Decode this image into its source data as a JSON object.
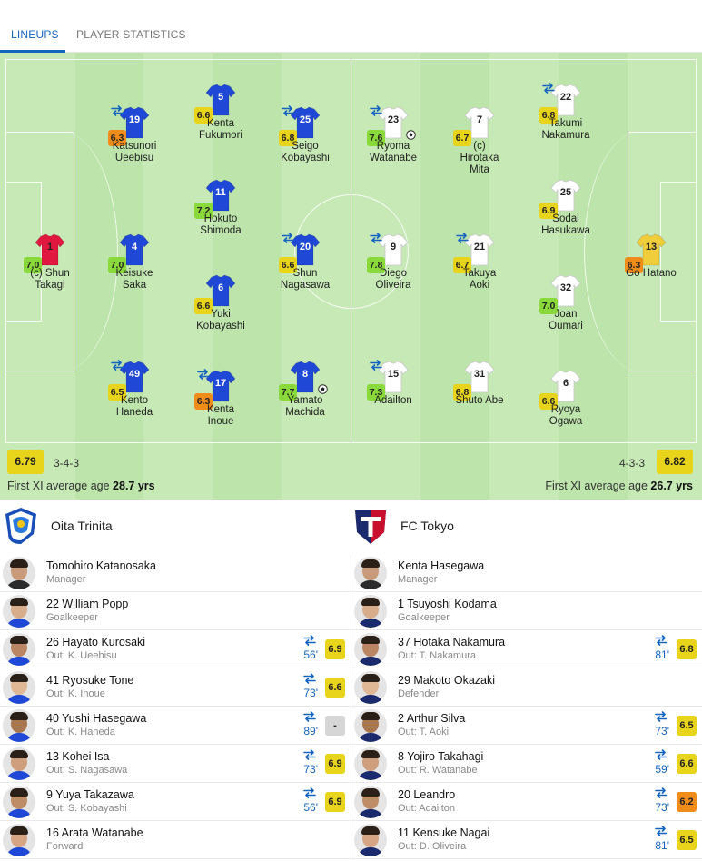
{
  "tabs": [
    {
      "label": "LINEUPS",
      "active": true
    },
    {
      "label": "PLAYER STATISTICS",
      "active": false
    }
  ],
  "colors": {
    "accent": "#1565c0",
    "home_kit": "#1f48d6",
    "away_kit": "#ffffff",
    "home_gk": "#e0173f",
    "away_gk": "#f0cd3a"
  },
  "lineups": {
    "home": {
      "average_rating": "6.79",
      "formation": "3-4-3",
      "avg_age_label": "First XI average age",
      "avg_age_value": "28.7 yrs",
      "players": [
        {
          "number": "1",
          "name": "(c) Shun\nTakagi",
          "rating": "7.0",
          "rc": "r-green",
          "gk": true
        },
        {
          "number": "4",
          "name": "Keisuke\nSaka",
          "rating": "7.0",
          "rc": "r-green"
        },
        {
          "number": "19",
          "name": "Katsunori\nUeebisu",
          "rating": "6.3",
          "rc": "r-orange",
          "sub": true
        },
        {
          "number": "49",
          "name": "Kento\nHaneda",
          "rating": "6.5",
          "rc": "r-yellow",
          "sub": true
        },
        {
          "number": "5",
          "name": "Kenta\nFukumori",
          "rating": "6.6",
          "rc": "r-yellow"
        },
        {
          "number": "11",
          "name": "Hokuto\nShimoda",
          "rating": "7.2",
          "rc": "r-green"
        },
        {
          "number": "6",
          "name": "Yuki\nKobayashi",
          "rating": "6.6",
          "rc": "r-yellow"
        },
        {
          "number": "17",
          "name": "Kenta\nInoue",
          "rating": "6.3",
          "rc": "r-orange",
          "sub": true
        },
        {
          "number": "25",
          "name": "Seigo\nKobayashi",
          "rating": "6.8",
          "rc": "r-yellow",
          "sub": true
        },
        {
          "number": "20",
          "name": "Shun\nNagasawa",
          "rating": "6.6",
          "rc": "r-yellow",
          "sub": true
        },
        {
          "number": "8",
          "name": "Yamato\nMachida",
          "rating": "7.7",
          "rc": "r-green",
          "goal": true
        }
      ]
    },
    "away": {
      "average_rating": "6.82",
      "formation": "4-3-3",
      "avg_age_label": "First XI average age",
      "avg_age_value": "26.7 yrs",
      "players": [
        {
          "number": "23",
          "name": "Ryoma\nWatanabe",
          "rating": "7.6",
          "rc": "r-green",
          "sub": true,
          "goal": true
        },
        {
          "number": "9",
          "name": "Diego\nOliveira",
          "rating": "7.8",
          "rc": "r-green",
          "sub": true
        },
        {
          "number": "15",
          "name": "Adailton",
          "rating": "7.3",
          "rc": "r-green",
          "sub": true
        },
        {
          "number": "7",
          "name": "(c)\nHirotaka\nMita",
          "rating": "6.7",
          "rc": "r-yellow"
        },
        {
          "number": "21",
          "name": "Takuya\nAoki",
          "rating": "6.7",
          "rc": "r-yellow",
          "sub": true
        },
        {
          "number": "31",
          "name": "Shuto Abe",
          "rating": "6.8",
          "rc": "r-yellow"
        },
        {
          "number": "22",
          "name": "Takumi\nNakamura",
          "rating": "6.8",
          "rc": "r-yellow",
          "sub": true
        },
        {
          "number": "25",
          "name": "Sodai\nHasukawa",
          "rating": "6.9",
          "rc": "r-yellow"
        },
        {
          "number": "32",
          "name": "Joan\nOumari",
          "rating": "7.0",
          "rc": "r-green"
        },
        {
          "number": "6",
          "name": "Ryoya\nOgawa",
          "rating": "6.6",
          "rc": "r-yellow"
        },
        {
          "number": "13",
          "name": "Go Hatano",
          "rating": "6.3",
          "rc": "r-orange",
          "gk": true
        }
      ]
    }
  },
  "teams": {
    "home": {
      "name": "Oita Trinita",
      "rows": [
        {
          "name": "Tomohiro Katanosaka",
          "sub": "Manager"
        },
        {
          "name": "22  William Popp",
          "sub": "Goalkeeper"
        },
        {
          "name": "26  Hayato Kurosaki",
          "sub": "Out: K. Ueebisu",
          "minute": "56'",
          "rating": "6.9",
          "rc": "r-yellow"
        },
        {
          "name": "41  Ryosuke Tone",
          "sub": "Out: K. Inoue",
          "minute": "73'",
          "rating": "6.6",
          "rc": "r-yellow"
        },
        {
          "name": "40  Yushi Hasegawa",
          "sub": "Out: K. Haneda",
          "minute": "89'",
          "rating": "-",
          "rc": "r-grey"
        },
        {
          "name": "13  Kohei Isa",
          "sub": "Out: S. Nagasawa",
          "minute": "73'",
          "rating": "6.9",
          "rc": "r-yellow"
        },
        {
          "name": "9  Yuya Takazawa",
          "sub": "Out: S. Kobayashi",
          "minute": "56'",
          "rating": "6.9",
          "rc": "r-yellow"
        },
        {
          "name": "16  Arata Watanabe",
          "sub": "Forward"
        }
      ]
    },
    "away": {
      "name": "FC Tokyo",
      "rows": [
        {
          "name": "Kenta Hasegawa",
          "sub": "Manager"
        },
        {
          "name": "1  Tsuyoshi Kodama",
          "sub": "Goalkeeper"
        },
        {
          "name": "37  Hotaka Nakamura",
          "sub": "Out: T. Nakamura",
          "minute": "81'",
          "rating": "6.8",
          "rc": "r-yellow"
        },
        {
          "name": "29  Makoto Okazaki",
          "sub": "Defender"
        },
        {
          "name": "2  Arthur Silva",
          "sub": "Out: T. Aoki",
          "minute": "73'",
          "rating": "6.5",
          "rc": "r-yellow"
        },
        {
          "name": "8  Yojiro Takahagi",
          "sub": "Out: R. Watanabe",
          "minute": "59'",
          "rating": "6.6",
          "rc": "r-yellow"
        },
        {
          "name": "20  Leandro",
          "sub": "Out: Adailton",
          "minute": "73'",
          "rating": "6.2",
          "rc": "r-orange"
        },
        {
          "name": "11  Kensuke Nagai",
          "sub": "Out: D. Oliveira",
          "minute": "81'",
          "rating": "6.5",
          "rc": "r-yellow"
        }
      ]
    }
  }
}
